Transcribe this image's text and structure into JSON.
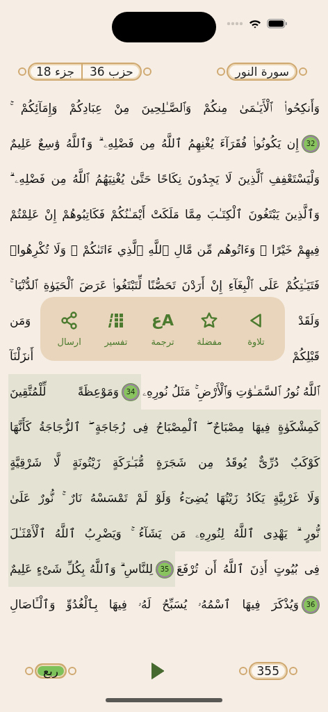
{
  "header": {
    "surah": "سورة النور",
    "hizb": "حزب 36",
    "juz": "جزء 18"
  },
  "lines": [
    {
      "segments": [
        {
          "kind": "text",
          "text": "وَأَنكِحُوا۟ ٱلْأَيَـٰمَىٰ مِنكُمْ وَٱلصَّـٰلِحِينَ مِنْ عِبَادِكُمْ وَإِمَآئِكُمْ ۚ",
          "highlighted": false
        }
      ]
    },
    {
      "segments": [
        {
          "kind": "marker",
          "text": "32",
          "highlighted": false
        },
        {
          "kind": "text",
          "text": "إِن يَكُونُوا۟ فُقَرَآءَ يُغْنِهِمُ ٱللَّهُ مِن فَضْلِهِۦ ۗ وَٱللَّهُ وَٰسِعٌ عَلِيمٌ",
          "highlighted": false
        }
      ]
    },
    {
      "segments": [
        {
          "kind": "text",
          "text": "وَلْيَسْتَعْفِفِ ٱلَّذِينَ لَا يَجِدُونَ نِكَاحًا حَتَّىٰ يُغْنِيَهُمُ ٱللَّهُ مِن فَضْلِهِۦ ۗ",
          "highlighted": false
        }
      ]
    },
    {
      "segments": [
        {
          "kind": "text",
          "text": "وَٱلَّذِينَ يَبْتَغُونَ ٱلْكِتَـٰبَ مِمَّا مَلَكَتْ أَيْمَـٰنُكُمْ فَكَاتِبُوهُمْ إِنْ عَلِمْتُمْ",
          "highlighted": false
        }
      ]
    },
    {
      "segments": [
        {
          "kind": "text",
          "text": "فِيهِمْ خَيْرًا ۖ وَءَاتُوهُم مِّن مَّالِ ٱللَّهِ ٱلَّذِي ءَاتَىٰكُمْ ۚ وَلَا تُكْرِهُوا۟",
          "highlighted": false
        }
      ]
    },
    {
      "segments": [
        {
          "kind": "text",
          "text": "فَتَيَـٰتِكُمْ عَلَى ٱلْبِغَآءِ إِنْ أَرَدْنَ تَحَصُّنًا لِّتَبْتَغُوا۟ عَرَضَ ٱلْحَيَوٰةِ ٱلدُّنْيَا ۚ",
          "highlighted": false
        }
      ]
    },
    {
      "segments": [
        {
          "kind": "fragment",
          "text": "وَلَقَدْ",
          "highlighted": false
        },
        {
          "kind": "fragment",
          "text": "وَمَن",
          "highlighted": false
        }
      ]
    },
    {
      "segments": [
        {
          "kind": "fragment",
          "text": "قَبْلِكُمْ",
          "highlighted": false
        },
        {
          "kind": "fragment",
          "text": "أَنزَلْنَآ",
          "highlighted": false
        }
      ]
    },
    {
      "segments": [
        {
          "kind": "text",
          "text": "ٱللَّهُ نُورُ ٱلسَّمَـٰوَٰتِ وَٱلْأَرْضِ ۚ مَثَلُ نُورِهِۦ",
          "highlighted": false
        },
        {
          "kind": "marker",
          "text": "34",
          "highlighted": true
        },
        {
          "kind": "text",
          "text": "وَمَوْعِظَةً لِّلْمُتَّقِينَ",
          "highlighted": true
        }
      ]
    },
    {
      "segments": [
        {
          "kind": "text",
          "text": "كَمِشْكَوٰةٍ فِيهَا مِصْبَاحٌ ۖ ٱلْمِصْبَاحُ فِى زُجَاجَةٍ ۖ ٱلزُّجَاجَةُ كَأَنَّهَا",
          "highlighted": true
        }
      ]
    },
    {
      "segments": [
        {
          "kind": "text",
          "text": "كَوْكَبٌ دُرِّىٌّ يُوقَدُ مِن شَجَرَةٍ مُّبَـٰرَكَةٍ زَيْتُونَةٍ لَّا شَرْقِيَّةٍ",
          "highlighted": true
        }
      ]
    },
    {
      "segments": [
        {
          "kind": "text",
          "text": "وَلَا غَرْبِيَّةٍ يَكَادُ زَيْتُهَا يُضِىٓءُ وَلَوْ لَمْ تَمْسَسْهُ نَارٌ ۚ نُّورٌ عَلَىٰ",
          "highlighted": true
        }
      ]
    },
    {
      "segments": [
        {
          "kind": "text",
          "text": "نُّورٍ ۗ يَهْدِى ٱللَّهُ لِنُورِهِۦ مَن يَشَآءُ ۚ وَيَضْرِبُ ٱللَّهُ ٱلْأَمْثَـٰلَ",
          "highlighted": true
        }
      ]
    },
    {
      "segments": [
        {
          "kind": "text",
          "text": "فِى بُيُوتٍ أَذِنَ ٱللَّهُ أَن تُرْفَعَ",
          "highlighted": false
        },
        {
          "kind": "marker",
          "text": "35",
          "highlighted": true
        },
        {
          "kind": "text",
          "text": "لِلنَّاسِ ۗ وَٱللَّهُ بِكُلِّ شَىْءٍ عَلِيمٌ",
          "highlighted": true
        }
      ]
    },
    {
      "segments": [
        {
          "kind": "marker",
          "text": "36",
          "highlighted": false
        },
        {
          "kind": "text",
          "text": "وَيُذْكَرَ فِيهَا ٱسْمُهُۥ يُسَبِّحُ لَهُۥ فِيهَا بِٱلْغُدُوِّ وَٱلْـَٔاصَالِ",
          "highlighted": false
        }
      ]
    }
  ],
  "actions": [
    {
      "kind": "recite",
      "label": "تلاوة"
    },
    {
      "kind": "favorite",
      "label": "مفضلة"
    },
    {
      "kind": "translate",
      "label": "ترجمة",
      "glyph": "Aع"
    },
    {
      "kind": "tafsir",
      "label": "تفسير"
    },
    {
      "kind": "share",
      "label": "ارسال"
    }
  ],
  "footer": {
    "quarter": "ربع",
    "page": "355"
  }
}
